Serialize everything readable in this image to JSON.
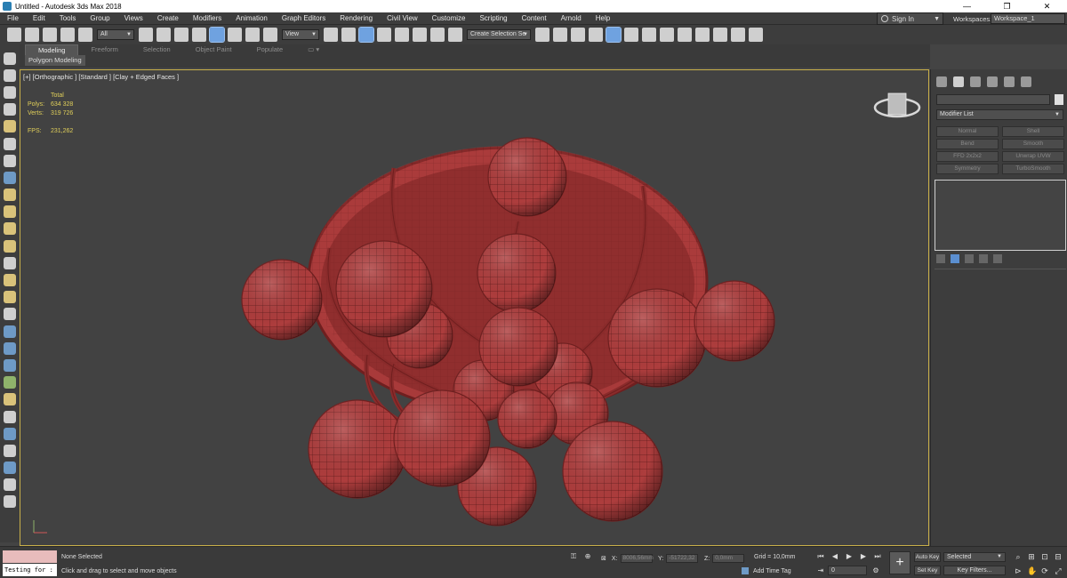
{
  "titlebar": {
    "title": "Untitled - Autodesk 3ds Max 2018",
    "minimize": "—",
    "maximize": "❐",
    "close": "✕"
  },
  "menu": {
    "items": [
      "File",
      "Edit",
      "Tools",
      "Group",
      "Views",
      "Create",
      "Modifiers",
      "Animation",
      "Graph Editors",
      "Rendering",
      "Civil View",
      "Customize",
      "Scripting",
      "Content",
      "Arnold",
      "Help"
    ],
    "sign_in": "Sign In",
    "workspaces_label": "Workspaces:",
    "workspace_value": "Workspace_1"
  },
  "toolbar": {
    "selection_filter": "All",
    "reference_coord": "View",
    "named_selection": "Create Selection Se"
  },
  "ribbon": {
    "tabs": [
      "Modeling",
      "Freeform",
      "Selection",
      "Object Paint",
      "Populate"
    ],
    "active_tab": "Modeling",
    "sub_label": "Polygon Modeling"
  },
  "viewport": {
    "label": "[+] [Orthographic ] [Standard ] [Clay + Edged Faces ]",
    "stats": {
      "total_label": "Total",
      "polys_label": "Polys:",
      "polys_value": "634 328",
      "verts_label": "Verts:",
      "verts_value": "319 726",
      "fps_label": "FPS:",
      "fps_value": "231,262"
    },
    "colors": {
      "model": "#a83a3a",
      "model_dark": "#6f1f1f",
      "background": "#424242",
      "border": "#c9b04a"
    }
  },
  "command_panel": {
    "modifier_list": "Modifier List",
    "modifiers": [
      "Normal",
      "Shell",
      "Bend",
      "Smooth",
      "FFD 2x2x2",
      "Unwrap UVW",
      "Symmetry",
      "TurboSmooth"
    ]
  },
  "status": {
    "maxscript_input": "Testing for :",
    "selection": "None Selected",
    "prompt": "Click and drag to select and move objects",
    "x_label": "X:",
    "x_value": "8006,56mm",
    "y_label": "Y:",
    "y_value": "-51722,32",
    "z_label": "Z:",
    "z_value": "0,0mm",
    "grid": "Grid = 10,0mm",
    "add_time_tag": "Add Time Tag",
    "frame": "0",
    "auto_key": "Auto Key",
    "set_key": "Set Key",
    "selected": "Selected",
    "key_filters": "Key Filters..."
  }
}
